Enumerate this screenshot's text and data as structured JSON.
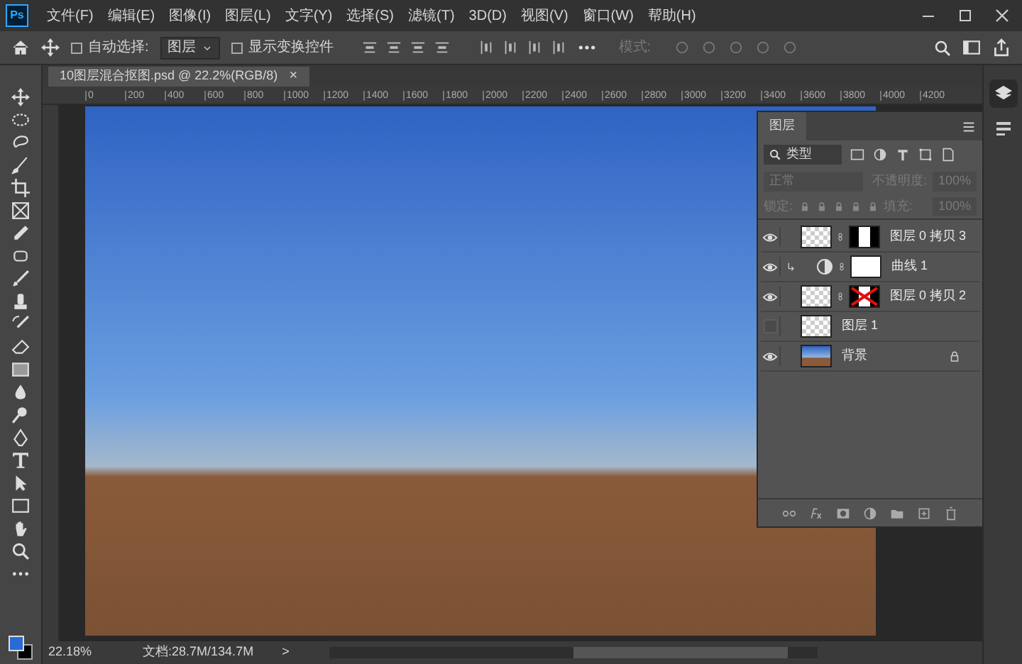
{
  "app_icon": "Ps",
  "menu": [
    "文件(F)",
    "编辑(E)",
    "图像(I)",
    "图层(L)",
    "文字(Y)",
    "选择(S)",
    "滤镜(T)",
    "3D(D)",
    "视图(V)",
    "窗口(W)",
    "帮助(H)"
  ],
  "options_bar": {
    "auto_select": {
      "label": "自动选择:",
      "checked": false
    },
    "target": "图层",
    "transform_controls": {
      "label": "显示变换控件",
      "checked": false
    },
    "mode_label": "模式:"
  },
  "document_tab": {
    "title": "10图层混合抠图.psd @ 22.2%(RGB/8)",
    "close": "×"
  },
  "ruler": [
    "0",
    "200",
    "400",
    "600",
    "800",
    "1000",
    "1200",
    "1400",
    "1600",
    "1800",
    "2000",
    "2200",
    "2400",
    "2600",
    "2800",
    "3000",
    "3200",
    "3400",
    "3600",
    "3800",
    "4000",
    "4200"
  ],
  "layers_panel": {
    "tab": "图层",
    "filter": "类型",
    "blend_mode": "正常",
    "opacity_label": "不透明度:",
    "opacity": "100%",
    "lock_label": "锁定:",
    "fill_label": "填充:",
    "fill": "100%",
    "layers": [
      {
        "name": "图层 0 拷贝 3",
        "kind": "pixel",
        "visible": true,
        "clipped": false,
        "mask": true,
        "mask_disabled": false,
        "locked": false
      },
      {
        "name": "曲线 1",
        "kind": "adjustment",
        "visible": true,
        "clipped": true,
        "mask": true,
        "mask_disabled": false,
        "locked": false
      },
      {
        "name": "图层 0 拷贝 2",
        "kind": "pixel",
        "visible": true,
        "clipped": false,
        "mask": true,
        "mask_disabled": true,
        "locked": false
      },
      {
        "name": "图层 1",
        "kind": "pixel",
        "visible": false,
        "clipped": false,
        "mask": false,
        "locked": false
      },
      {
        "name": "背景",
        "kind": "background",
        "visible": true,
        "clipped": false,
        "mask": false,
        "locked": true
      }
    ]
  },
  "status_bar": {
    "zoom": "22.18%",
    "doc_size": "文档:28.7M/134.7M",
    "arrow": ">"
  }
}
